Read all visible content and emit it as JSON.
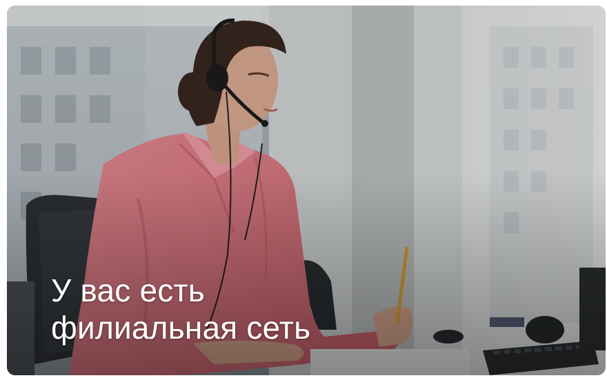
{
  "banner": {
    "image_alt": "Woman with headset working in office",
    "headline_line1": "У вас есть",
    "headline_line2": "филиальная сеть"
  },
  "colors": {
    "shirt": "#d96f79",
    "wall": "#cfd3d6",
    "pillar": "#bfc2c2",
    "text": "#ffffff"
  }
}
